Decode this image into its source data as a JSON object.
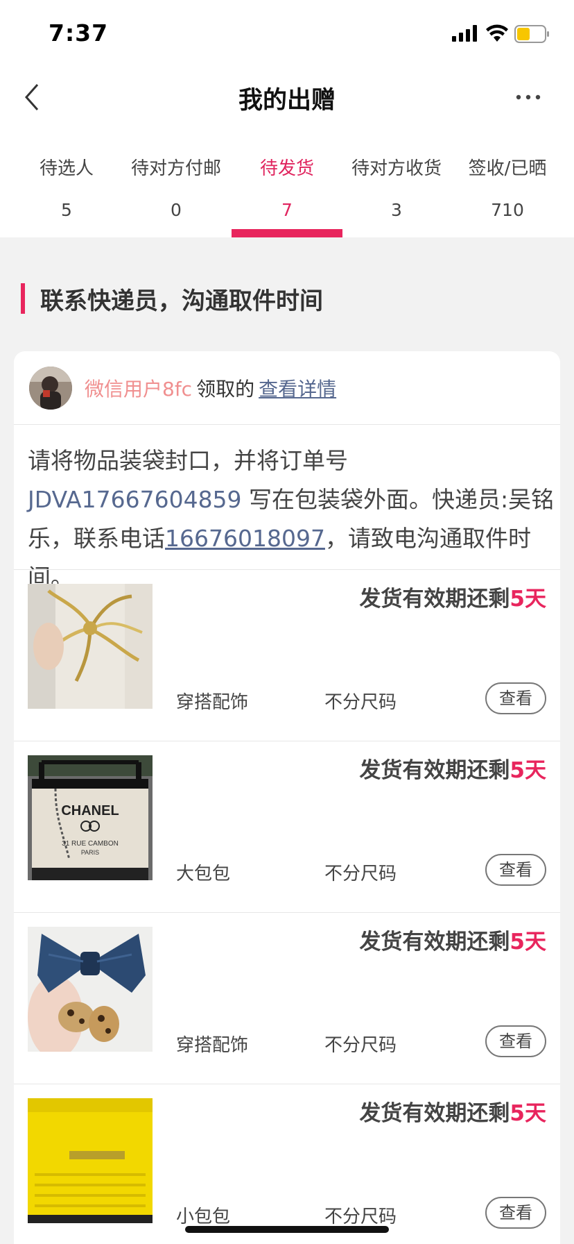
{
  "status_bar": {
    "time": "7:37"
  },
  "nav": {
    "title": "我的出赠"
  },
  "tabs": [
    {
      "label": "待选人",
      "count": "5"
    },
    {
      "label": "待对方付邮",
      "count": "0"
    },
    {
      "label": "待发货",
      "count": "7"
    },
    {
      "label": "待对方收货",
      "count": "3"
    },
    {
      "label": "签收/已晒",
      "count": "710"
    }
  ],
  "active_tab_index": 2,
  "section": {
    "heading": "联系快递员，沟通取件时间"
  },
  "card": {
    "user_name": "微信用户8fc",
    "user_action": "领取的",
    "detail_link": "查看详情",
    "instructions": {
      "part1": "请将物品装袋封口，并将订单号 ",
      "order_number": "JDVA17667604859",
      "part2": " 写在包装袋外面。快递员:吴铭乐，联系电话",
      "phone": "16676018097",
      "part3": "，请致电沟通取件时间。"
    }
  },
  "items": [
    {
      "deadline_prefix": "发货有效期还剩",
      "deadline_days": "5天",
      "category": "穿搭配饰",
      "size": "不分尺码",
      "view_label": "查看",
      "thumb": "gold-flower-hairpin"
    },
    {
      "deadline_prefix": "发货有效期还剩",
      "deadline_days": "5天",
      "category": "大包包",
      "size": "不分尺码",
      "view_label": "查看",
      "thumb": "canvas-tote-bag",
      "thumb_text": {
        "brand": "CHANEL",
        "line1": "31 RUE CAMBON",
        "line2": "PARIS"
      }
    },
    {
      "deadline_prefix": "发货有效期还剩",
      "deadline_days": "5天",
      "category": "穿搭配饰",
      "size": "不分尺码",
      "view_label": "查看",
      "thumb": "denim-bow-clip"
    },
    {
      "deadline_prefix": "发货有效期还剩",
      "deadline_days": "5天",
      "category": "小包包",
      "size": "不分尺码",
      "view_label": "查看",
      "thumb": "yellow-pouch"
    }
  ],
  "colors": {
    "accent": "#e8255d",
    "link": "#56688f",
    "username": "#f08f8f",
    "background": "#f2f2f2"
  }
}
